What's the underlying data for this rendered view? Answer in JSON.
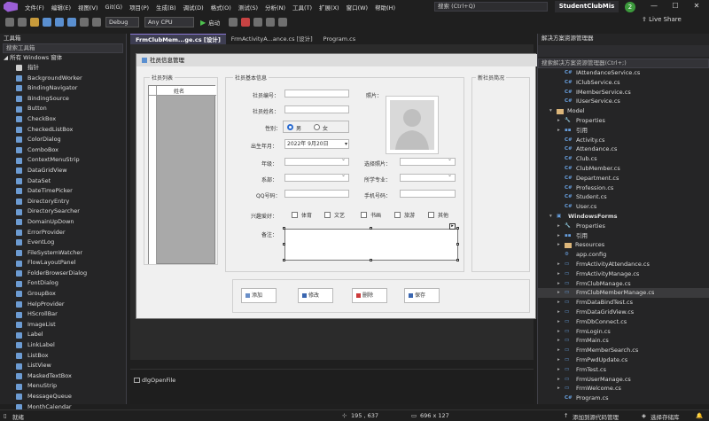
{
  "menu": {
    "items": [
      "文件(F)",
      "编辑(E)",
      "视图(V)",
      "Git(G)",
      "项目(P)",
      "生成(B)",
      "调试(D)",
      "格式(O)",
      "测试(S)",
      "分析(N)",
      "工具(T)",
      "扩展(X)",
      "窗口(W)",
      "帮助(H)"
    ],
    "search_placeholder": "搜索 (Ctrl+Q)",
    "app_name": "StudentClubMis",
    "badge": "2"
  },
  "toolbar": {
    "config": "Debug",
    "platform": "Any CPU",
    "start": "启动",
    "live_share": "Live Share"
  },
  "toolbox": {
    "title": "工具箱",
    "search_placeholder": "搜索工具箱",
    "group": "◢ 所有 Windows 窗体",
    "items": [
      "指针",
      "BackgroundWorker",
      "BindingNavigator",
      "BindingSource",
      "Button",
      "CheckBox",
      "CheckedListBox",
      "ColorDialog",
      "ComboBox",
      "ContextMenuStrip",
      "DataGridView",
      "DataSet",
      "DateTimePicker",
      "DirectoryEntry",
      "DirectorySearcher",
      "DomainUpDown",
      "ErrorProvider",
      "EventLog",
      "FileSystemWatcher",
      "FlowLayoutPanel",
      "FolderBrowserDialog",
      "FontDialog",
      "GroupBox",
      "HelpProvider",
      "HScrollBar",
      "ImageList",
      "Label",
      "LinkLabel",
      "ListBox",
      "ListView",
      "MaskedTextBox",
      "MenuStrip",
      "MessageQueue",
      "MonthCalendar"
    ]
  },
  "tabs": [
    {
      "label": "FrmClubMem...ge.cs [设计]"
    },
    {
      "label": "FrmActivityA...ance.cs [设计]"
    },
    {
      "label": "Program.cs"
    }
  ],
  "form": {
    "title": "社员信息管理",
    "member_list_legend": "社员列表",
    "grid_header": "姓名",
    "basic_info_legend": "社员基本信息",
    "new_member_legend": "新社员简况",
    "labels": {
      "member_id": "社员编号：",
      "member_name": "社员姓名：",
      "gender": "性别：",
      "birthdate": "出生年月：",
      "grade": "年级：",
      "department": "系部：",
      "qq": "QQ号码：",
      "photo": "照片：",
      "select_photo": "选择照片：",
      "major": "所学专业：",
      "phone": "手机号码：",
      "hobbies": "兴趣爱好：",
      "remarks": "备注："
    },
    "gender_options": [
      "男",
      "女"
    ],
    "birthdate_value": "2022年 9月20日",
    "hobbies": [
      "体育",
      "文艺",
      "书画",
      "旅游",
      "其他"
    ],
    "buttons": [
      "添加",
      "修改",
      "删除",
      "保存"
    ]
  },
  "component_tray": {
    "item": "dlgOpenFile"
  },
  "solution": {
    "title": "解决方案资源管理器",
    "search_placeholder": "搜索解决方案资源管理器(Ctrl+;)",
    "items": [
      {
        "text": "IAttendanceService.cs",
        "kind": "cs",
        "indent": 2
      },
      {
        "text": "IClubService.cs",
        "kind": "cs",
        "indent": 2
      },
      {
        "text": "IMemberService.cs",
        "kind": "cs",
        "indent": 2
      },
      {
        "text": "IUserService.cs",
        "kind": "cs",
        "indent": 2
      },
      {
        "text": "Model",
        "kind": "folder",
        "indent": 1
      },
      {
        "text": "Properties",
        "kind": "wrench",
        "indent": 2
      },
      {
        "text": "引用",
        "kind": "ref",
        "indent": 2
      },
      {
        "text": "Activity.cs",
        "kind": "cs",
        "indent": 2
      },
      {
        "text": "Attendance.cs",
        "kind": "cs",
        "indent": 2
      },
      {
        "text": "Club.cs",
        "kind": "cs",
        "indent": 2
      },
      {
        "text": "ClubMember.cs",
        "kind": "cs",
        "indent": 2
      },
      {
        "text": "Department.cs",
        "kind": "cs",
        "indent": 2
      },
      {
        "text": "Profession.cs",
        "kind": "cs",
        "indent": 2
      },
      {
        "text": "Student.cs",
        "kind": "cs",
        "indent": 2
      },
      {
        "text": "User.cs",
        "kind": "cs",
        "indent": 2
      },
      {
        "text": "WindowsForms",
        "kind": "project",
        "indent": 1
      },
      {
        "text": "Properties",
        "kind": "wrench",
        "indent": 2
      },
      {
        "text": "引用",
        "kind": "ref",
        "indent": 2
      },
      {
        "text": "Resources",
        "kind": "folder",
        "indent": 2
      },
      {
        "text": "app.config",
        "kind": "config",
        "indent": 2
      },
      {
        "text": "FrmActivityAttendance.cs",
        "kind": "form",
        "indent": 2
      },
      {
        "text": "FrmActivityManage.cs",
        "kind": "form",
        "indent": 2
      },
      {
        "text": "FrmClubManage.cs",
        "kind": "form",
        "indent": 2
      },
      {
        "text": "FrmClubMemberManage.cs",
        "kind": "form",
        "indent": 2,
        "selected": true
      },
      {
        "text": "FrmDataBindTest.cs",
        "kind": "form",
        "indent": 2
      },
      {
        "text": "FrmDataGridView.cs",
        "kind": "form",
        "indent": 2
      },
      {
        "text": "FrmDbConnect.cs",
        "kind": "form",
        "indent": 2
      },
      {
        "text": "FrmLogin.cs",
        "kind": "form",
        "indent": 2
      },
      {
        "text": "FrmMain.cs",
        "kind": "form",
        "indent": 2
      },
      {
        "text": "FrmMemberSearch.cs",
        "kind": "form",
        "indent": 2
      },
      {
        "text": "FrmPwdUpdate.cs",
        "kind": "form",
        "indent": 2
      },
      {
        "text": "FrmTest.cs",
        "kind": "form",
        "indent": 2
      },
      {
        "text": "FrmUserManage.cs",
        "kind": "form",
        "indent": 2
      },
      {
        "text": "FrmWelcome.cs",
        "kind": "form",
        "indent": 2
      },
      {
        "text": "Program.cs",
        "kind": "cs",
        "indent": 2
      }
    ]
  },
  "status": {
    "ready": "就绪",
    "position": "195 , 637",
    "size": "696 x 127",
    "add_source": "添加到源代码管理",
    "select_repo": "选择存储库"
  }
}
